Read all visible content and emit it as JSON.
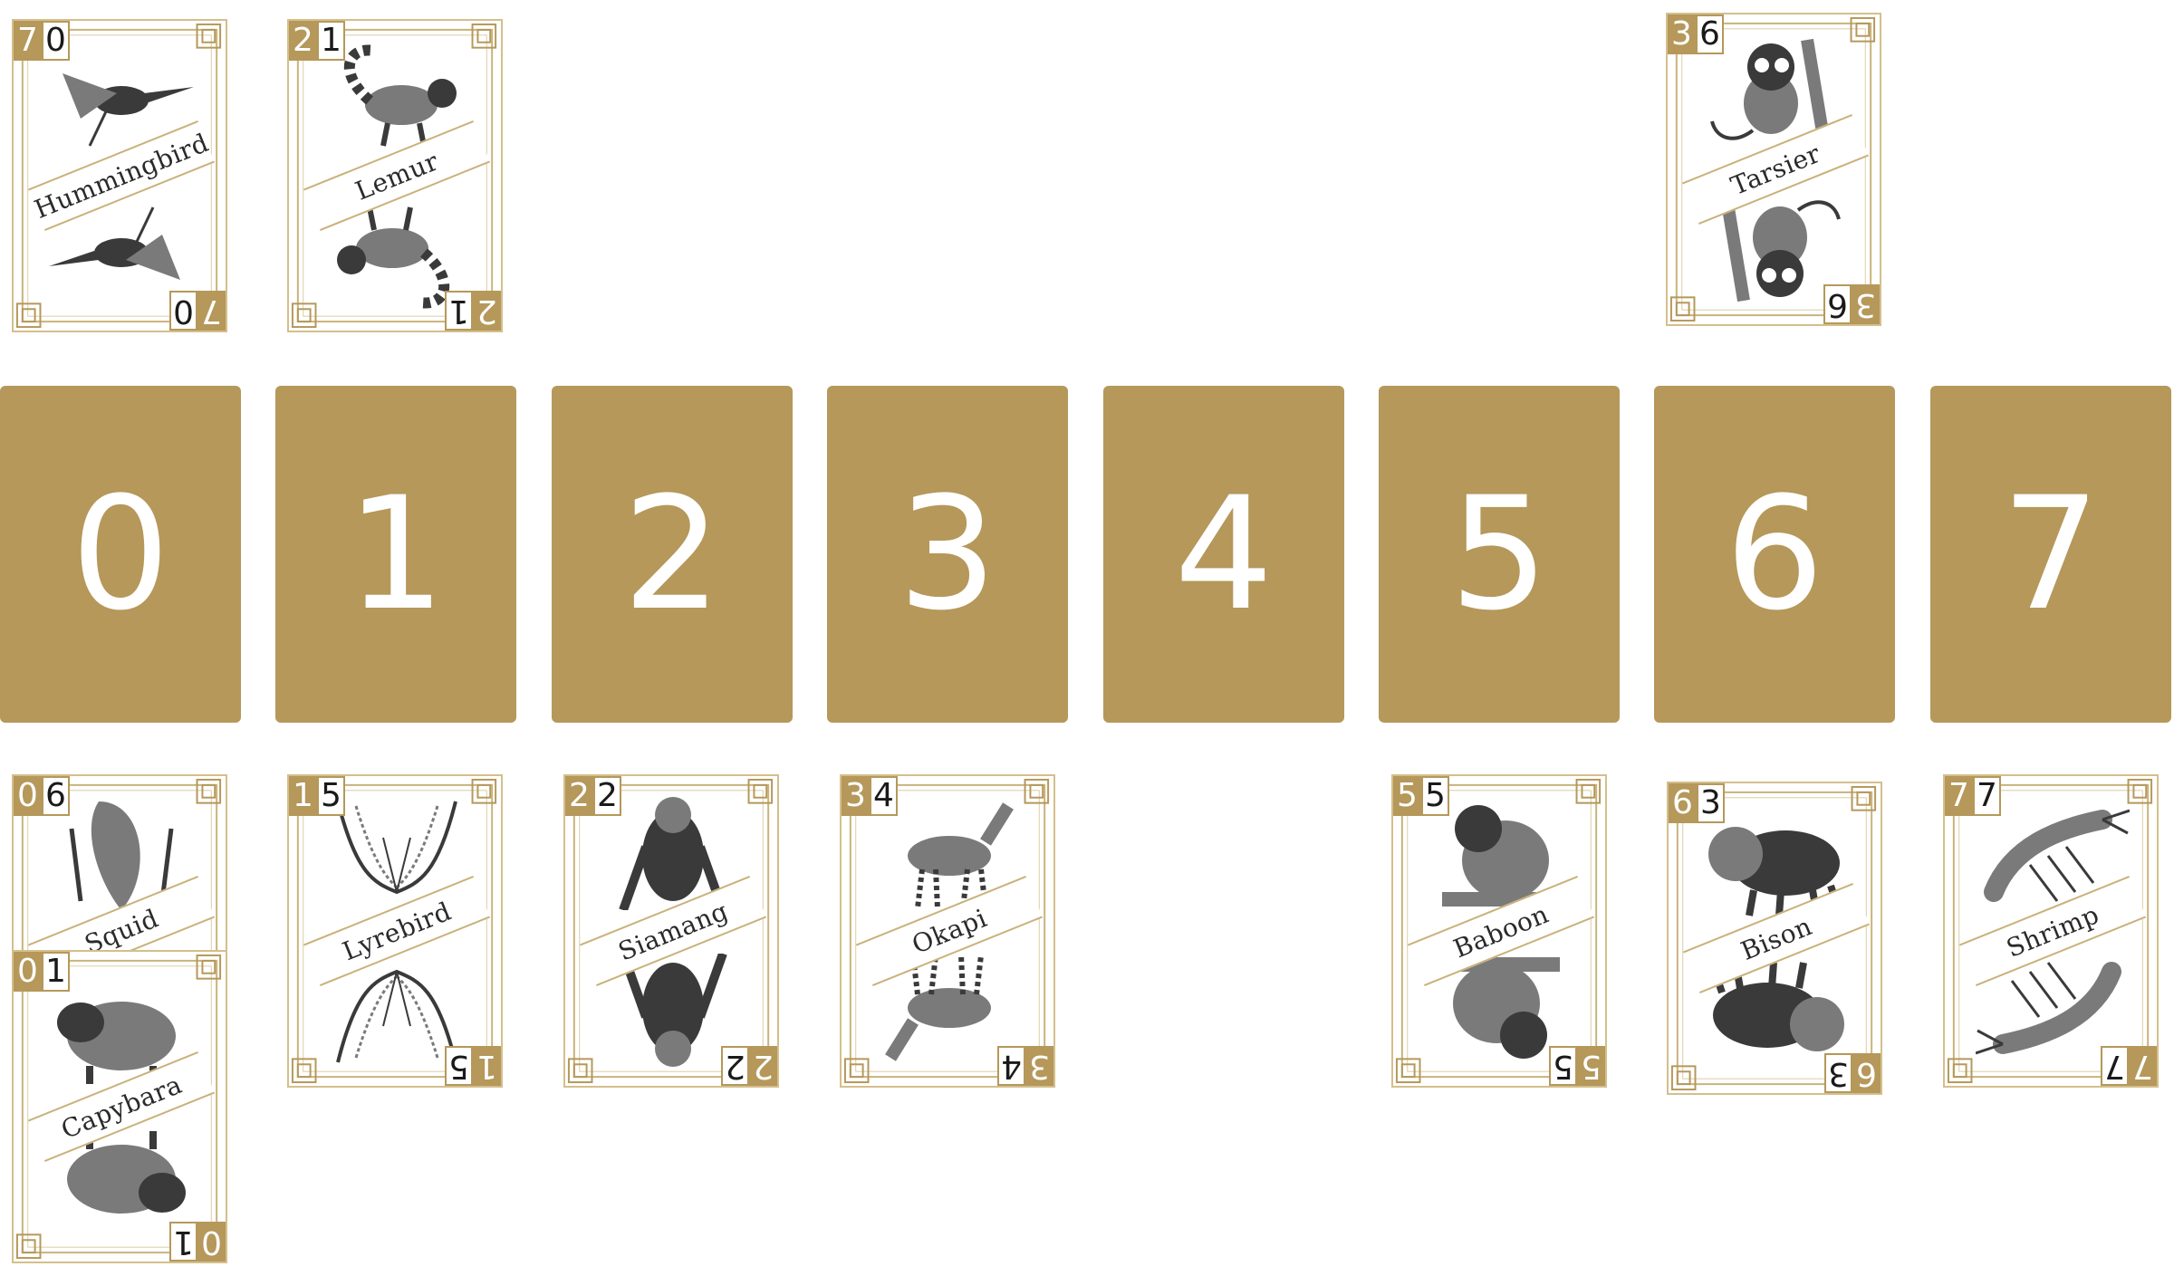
{
  "theme": {
    "gold": "#b5985a",
    "ink": "#2a2a2a"
  },
  "slots": [
    "0",
    "1",
    "2",
    "3",
    "4",
    "5",
    "6",
    "7"
  ],
  "cards": [
    {
      "id": "hummingbird",
      "name": "Hummingbird",
      "d1": "7",
      "d2": "0",
      "icon": "hummingbird-illustration"
    },
    {
      "id": "lemur",
      "name": "Lemur",
      "d1": "2",
      "d2": "1",
      "icon": "lemur-illustration"
    },
    {
      "id": "tarsier",
      "name": "Tarsier",
      "d1": "3",
      "d2": "6",
      "icon": "tarsier-illustration"
    },
    {
      "id": "squid",
      "name": "Squid",
      "d1": "0",
      "d2": "6",
      "icon": "squid-illustration"
    },
    {
      "id": "capybara",
      "name": "Capybara",
      "d1": "0",
      "d2": "1",
      "icon": "capybara-illustration"
    },
    {
      "id": "lyrebird",
      "name": "Lyrebird",
      "d1": "1",
      "d2": "5",
      "icon": "lyrebird-illustration"
    },
    {
      "id": "siamang",
      "name": "Siamang",
      "d1": "2",
      "d2": "2",
      "icon": "siamang-illustration"
    },
    {
      "id": "okapi",
      "name": "Okapi",
      "d1": "3",
      "d2": "4",
      "icon": "okapi-illustration"
    },
    {
      "id": "baboon",
      "name": "Baboon",
      "d1": "5",
      "d2": "5",
      "icon": "baboon-illustration"
    },
    {
      "id": "bison",
      "name": "Bison",
      "d1": "6",
      "d2": "3",
      "icon": "bison-illustration"
    },
    {
      "id": "shrimp",
      "name": "Shrimp",
      "d1": "7",
      "d2": "7",
      "icon": "shrimp-illustration"
    }
  ]
}
